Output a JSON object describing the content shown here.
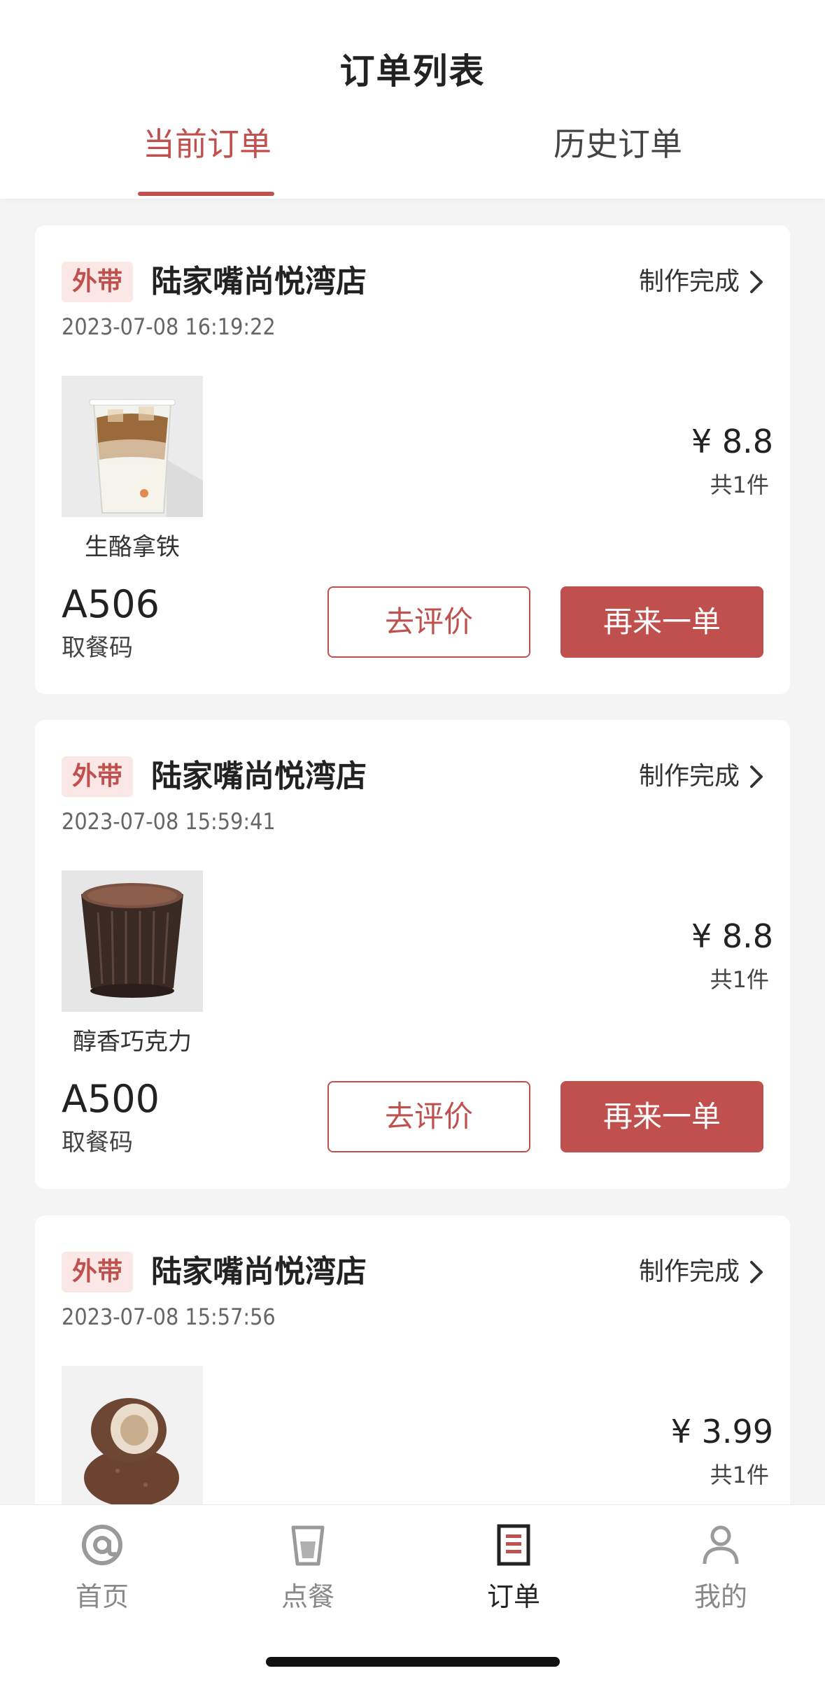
{
  "header": {
    "title": "订单列表",
    "tabs": [
      {
        "label": "当前订单",
        "active": true
      },
      {
        "label": "历史订单",
        "active": false
      }
    ]
  },
  "orders": [
    {
      "badge": "外带",
      "store": "陆家嘴尚悦湾店",
      "status": "制作完成",
      "datetime": "2023-07-08 16:19:22",
      "product_name": "生酪拿铁",
      "product_icon": "latte-cup-image",
      "price": "¥ 8.8",
      "qty": "共1件",
      "pickup_code": "A506",
      "pickup_label": "取餐码",
      "review_label": "去评价",
      "reorder_label": "再来一单"
    },
    {
      "badge": "外带",
      "store": "陆家嘴尚悦湾店",
      "status": "制作完成",
      "datetime": "2023-07-08 15:59:41",
      "product_name": "醇香巧克力",
      "product_icon": "hot-chocolate-glass-image",
      "price": "¥ 8.8",
      "qty": "共1件",
      "pickup_code": "A500",
      "pickup_label": "取餐码",
      "review_label": "去评价",
      "reorder_label": "再来一单"
    },
    {
      "badge": "外带",
      "store": "陆家嘴尚悦湾店",
      "status": "制作完成",
      "datetime": "2023-07-08 15:57:56",
      "product_name": "",
      "product_icon": "mochi-dessert-image",
      "price": "¥ 3.99",
      "qty": "共1件"
    }
  ],
  "tabbar": {
    "items": [
      {
        "label": "首页",
        "icon": "at-sign-icon",
        "active": false
      },
      {
        "label": "点餐",
        "icon": "cup-icon",
        "active": false
      },
      {
        "label": "订单",
        "icon": "order-list-icon",
        "active": true
      },
      {
        "label": "我的",
        "icon": "person-icon",
        "active": false
      }
    ]
  },
  "colors": {
    "accent": "#c0504d",
    "badge_bg": "#fbe8e6",
    "page_bg": "#f4f4f4"
  }
}
